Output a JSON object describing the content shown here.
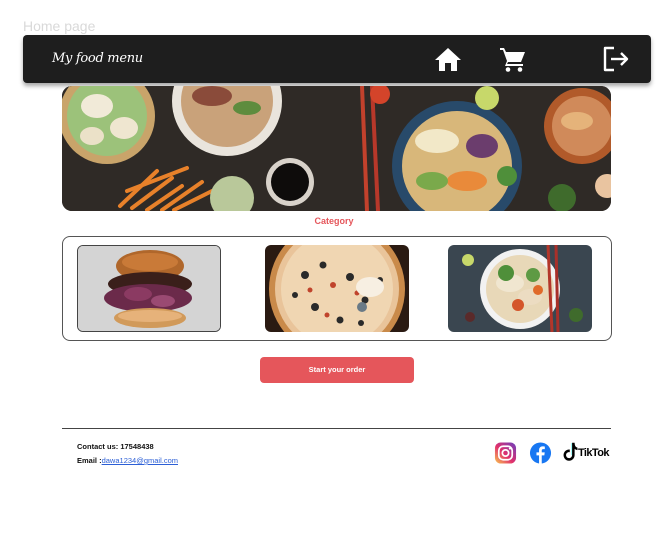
{
  "frame": {
    "label": "Home page"
  },
  "navbar": {
    "brand": "My food menu",
    "icons": {
      "home": "home-icon",
      "cart": "cart-icon",
      "logout": "logout-icon"
    }
  },
  "hero": {
    "image": "food-spread-banner"
  },
  "category": {
    "title": "Category",
    "items": [
      {
        "image": "burger-photo"
      },
      {
        "image": "pizza-photo"
      },
      {
        "image": "noodle-soup-photo"
      }
    ]
  },
  "cta": {
    "label": "Start your order"
  },
  "footer": {
    "contact": "Contact us: 17548438",
    "email_label": "Email :",
    "email": "dawa1234@gmail.com",
    "social": {
      "instagram": "instagram-icon",
      "facebook": "facebook-icon",
      "tiktok_label": "TikTok"
    }
  },
  "colors": {
    "accent": "#e5565b",
    "navbar": "#1e1e1e",
    "link": "#2c5fd6"
  }
}
